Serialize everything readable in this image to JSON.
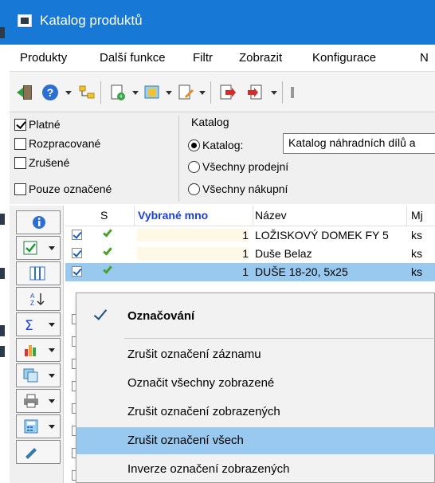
{
  "window": {
    "title": "Katalog produktů"
  },
  "menu": [
    "Produkty",
    "Další funkce",
    "Filtr",
    "Zobrazit",
    "Konfigurace",
    "N"
  ],
  "filters": {
    "checkboxes": [
      {
        "label": "Platné",
        "checked": true
      },
      {
        "label": "Rozpracované",
        "checked": false
      },
      {
        "label": "Zrušené",
        "checked": false
      },
      {
        "label": "Pouze označené",
        "checked": false
      }
    ],
    "catalog_group": {
      "title": "Katalog",
      "options": [
        {
          "label": "Katalog:",
          "selected": true
        },
        {
          "label": "Všechny prodejní",
          "selected": false
        },
        {
          "label": "Všechny nákupní",
          "selected": false
        }
      ],
      "catalog_value": "Katalog náhradních dílů a"
    }
  },
  "grid": {
    "columns": [
      "S",
      "Vybrané mno",
      "Název",
      "Mj"
    ],
    "rows": [
      {
        "checked": true,
        "status": "ok",
        "qty": "1",
        "name": "LOŽISKOVÝ DOMEK FY 5",
        "unit": "ks"
      },
      {
        "checked": true,
        "status": "ok",
        "qty": "1",
        "name": "Duše Belaz",
        "unit": "ks"
      },
      {
        "checked": true,
        "status": "ok",
        "qty": "1",
        "name": "DUŠE 18-20, 5x25",
        "unit": "ks",
        "selected": true
      }
    ]
  },
  "context_menu": {
    "items": [
      {
        "label": "Označování",
        "checked": true,
        "bold": true
      },
      {
        "label": "Zrušit označení záznamu"
      },
      {
        "label": "Označit všechny zobrazené"
      },
      {
        "label": "Zrušit označení zobrazených"
      },
      {
        "label": "Zrušit označení všech",
        "highlighted": true
      },
      {
        "label": "Inverze označení zobrazených"
      }
    ]
  },
  "colors": {
    "titlebar": "#1778d6",
    "highlight": "#99c9ef",
    "column_header_highlight": "#1a3fd6",
    "status_ok": "#4aa02c"
  }
}
